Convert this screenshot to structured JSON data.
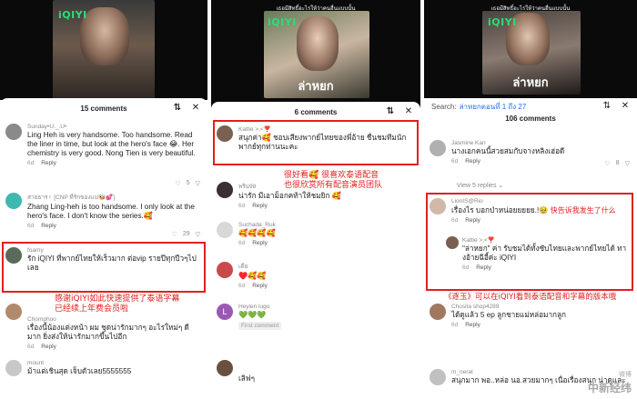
{
  "panel1": {
    "video_logo": "iQIYI",
    "count": "15 comments",
    "comments": [
      {
        "user": "Sunday•U._.U•",
        "text": "Ling Heh is very handsome. Too handsome. Read the liner in time, but look at the hero's face 😂. Her chemistry is very good. Nong Tien is very beautiful.",
        "meta": "6d",
        "reply": "Reply",
        "likes": "5"
      },
      {
        "user": "สายธาร♀ [CNP ที่รักของแม่🐝💕]",
        "text": "Zhang Ling-heh is too handsome. I only look at the hero's face. I don't know the series.🥰",
        "meta": "6d",
        "reply": "Reply",
        "likes": "29"
      },
      {
        "user": "foamy",
        "text": "รัก iQIYI ที่พากย์ไทยให้เร็วมาก ต่อvip รายปีทุกปีวๆไป เลย",
        "meta": "6d",
        "reply": "Reply",
        "likes": "4"
      },
      {
        "user": "Chomphoo",
        "text": "เรื่องนี้น้องแต่งหน้า ผม ชุดน่ารักมากๆ อะไรใหม่ๆ ดี มาก ยิ่งส่งให้น่ารักมากขึ้นไปอีก",
        "meta": "6d",
        "reply": "Reply",
        "likes": ""
      },
      {
        "user": "mount",
        "text": "ม้าแต่เชินสุด เจ็บตัวเลย5555555",
        "meta": "",
        "reply": "",
        "likes": ""
      }
    ],
    "note": "感谢iQIYI如此快速提供了泰语字幕\n已经续上年费会员啦"
  },
  "panel2": {
    "video_caption": "เธอมีสิทธิ์อะไรให้ว่าคนอื่นแบบนั้น",
    "video_logo": "iQIYI",
    "video_brand": "ล่าหยก",
    "count": "6 comments",
    "comments": [
      {
        "user": "Kattie >,<❣️",
        "text": "สนุกค่า🥰 ชอบเสียงพากย์ไทยของพี่อ้าย ชื่นชมทีมนัก พากย์ทุกท่านนะคะ",
        "meta": "",
        "reply": "",
        "likes": ""
      },
      {
        "user": "พริม98",
        "text": "น่ารัก มีเอาม็อกคท้าให้ชมยิก 🥰",
        "meta": "6d",
        "reply": "Reply",
        "likes": ""
      },
      {
        "user": "Suchada_Ruk",
        "text": "🥰🥰🥰🥰",
        "meta": "6d",
        "reply": "Reply",
        "likes": ""
      },
      {
        "user": "เดีย",
        "text": "♥️🥰🥰",
        "meta": "6d",
        "reply": "Reply",
        "likes": ""
      },
      {
        "user": "Heylen lugo",
        "text": "💚💚💚",
        "meta": "First comment",
        "reply": "",
        "likes": ""
      },
      {
        "user": "",
        "text": "เลิฟๆ",
        "meta": "",
        "reply": "",
        "likes": ""
      }
    ],
    "note": "很好看🥰 很喜欢泰语配音\n也很欣赏所有配音演员团队"
  },
  "panel3": {
    "video_caption": "เธอมีสิทธิ์อะไรให้ว่าคนอื่นแบบนั้น",
    "video_logo": "iQIYI",
    "video_brand": "ล่าหยก",
    "search_label": "Search:",
    "search_query": "ล่าหยกตอนที่ 1 ถึง 27",
    "count": "106 comments",
    "comments": [
      {
        "user": "Jasmine Kan",
        "text": "นางเอกคนนี้สวยสมกับจางหลิงเฮ่อดี",
        "meta": "6d",
        "reply": "Reply",
        "likes": "8"
      },
      {
        "user": "LionIS@Rio",
        "text": "เรื่องไร บอกป่าหน่อยยยยย.!🥹",
        "meta": "6d",
        "reply": "Reply",
        "likes": ""
      },
      {
        "user": "Kattie >,<❣️",
        "text": "\"ล่าหยก\" ค่า รับชมได้ทั้งซับไทยและพากย์ไทยได้ ทางอ้ายฉีอี้ค่ะ iQIYI",
        "meta": "6d",
        "reply": "Reply",
        "likes": ""
      },
      {
        "user": "Chosita shop4289",
        "text": "ได้ดูแล้ว 5 ep ลูกชายแม่หล่อมากลูก",
        "meta": "6d",
        "reply": "Reply",
        "likes": ""
      },
      {
        "user": "m_nerat",
        "text": "สนุกมาก พอ..หล่อ นอ.สวยมากๆ เนื่อเรื่องสนุก น่าดูและ",
        "meta": "",
        "reply": "",
        "likes": ""
      }
    ],
    "replies_label": "View 5 replies ⌄",
    "note_inline": "快告诉我发生了什么",
    "note": "《逐玉》可以在iQIYI看到泰语配音和字幕的版本哦",
    "weibo": "微博",
    "watermark": "中新经纬"
  }
}
